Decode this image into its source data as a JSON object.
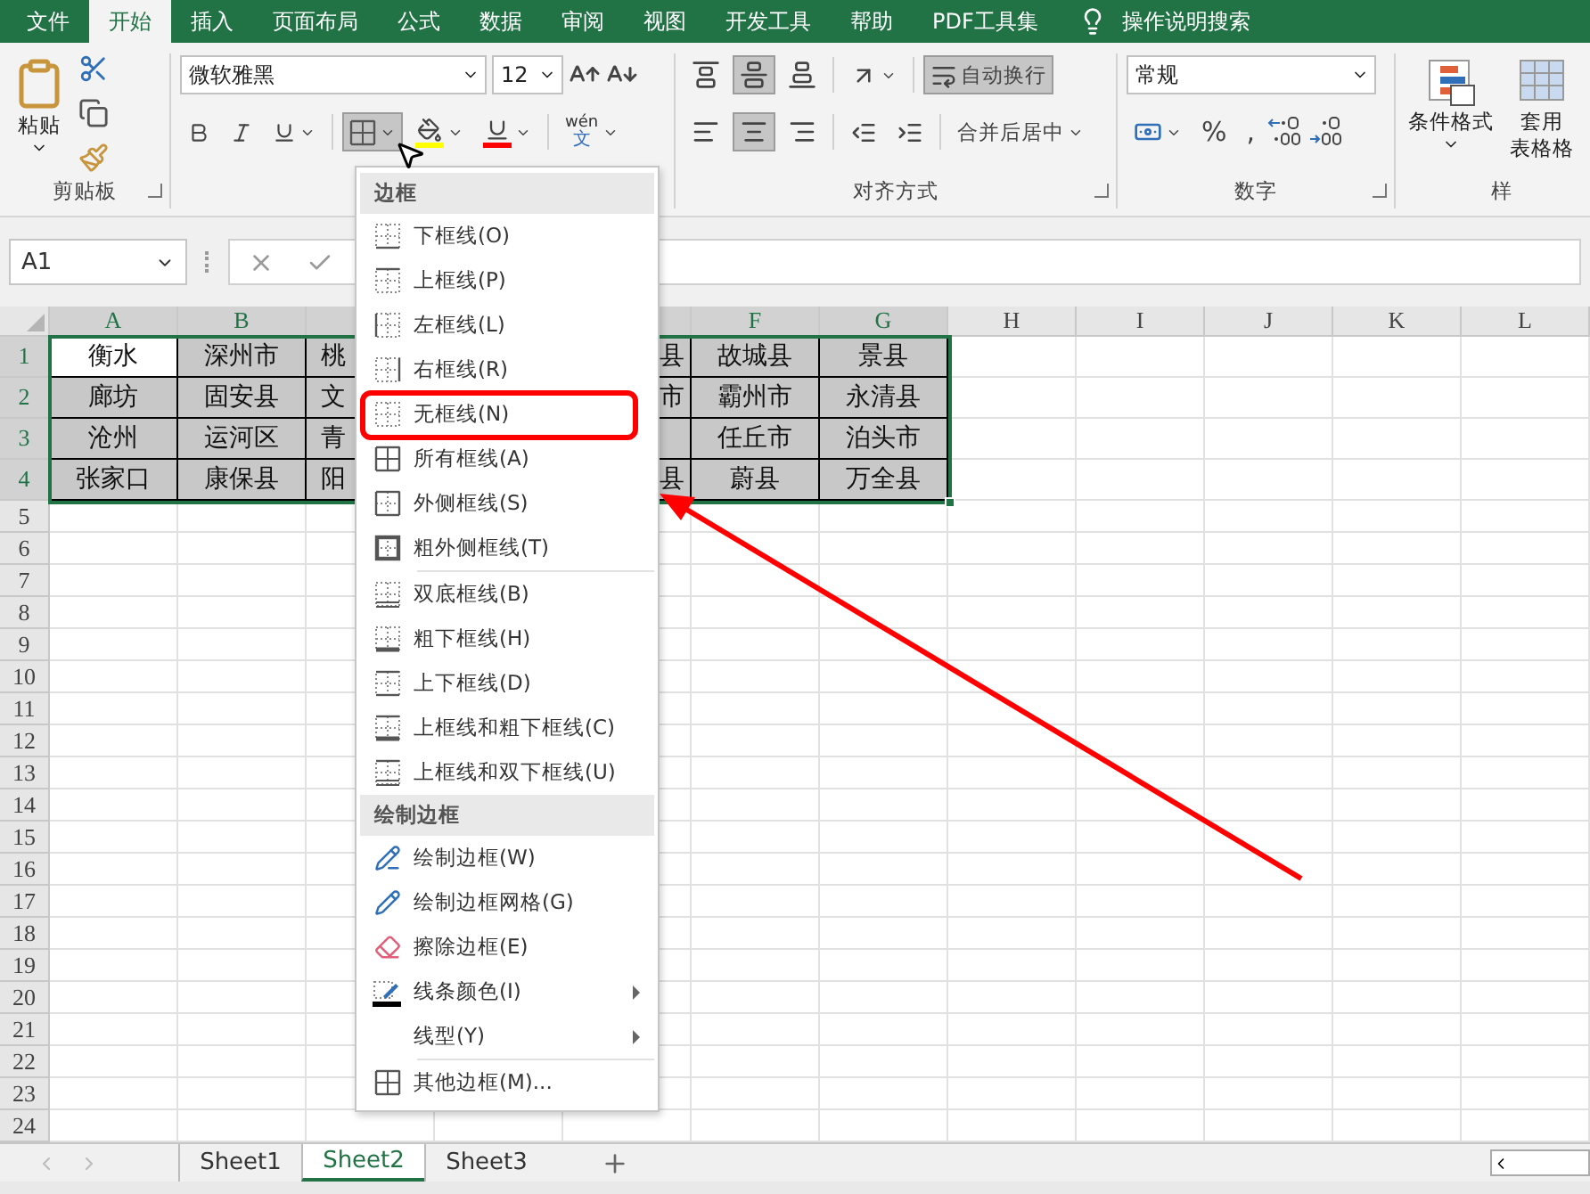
{
  "ribbon_tabs": [
    {
      "label": "文件",
      "selected": false
    },
    {
      "label": "开始",
      "selected": true
    },
    {
      "label": "插入",
      "selected": false
    },
    {
      "label": "页面布局",
      "selected": false
    },
    {
      "label": "公式",
      "selected": false
    },
    {
      "label": "数据",
      "selected": false
    },
    {
      "label": "审阅",
      "selected": false
    },
    {
      "label": "视图",
      "selected": false
    },
    {
      "label": "开发工具",
      "selected": false
    },
    {
      "label": "帮助",
      "selected": false
    },
    {
      "label": "PDF工具集",
      "selected": false
    }
  ],
  "tell_me": "操作说明搜索",
  "ribbon": {
    "clipboard": {
      "paste": "粘贴",
      "label": "剪贴板"
    },
    "font": {
      "name": "微软雅黑",
      "size": "12",
      "phonetic": "wén",
      "phonetic_char": "文",
      "borders_pressed": true
    },
    "alignment": {
      "middle_pressed": true,
      "center_pressed": true,
      "wrap": "自动换行",
      "wrap_pressed": true,
      "merge": "合并后居中",
      "label": "对齐方式"
    },
    "number": {
      "format": "常规",
      "percent": "%",
      "comma": ",",
      "label": "数字"
    },
    "styles": {
      "conditional": "条件格式",
      "table_top": "套用",
      "table_bottom": "表格格",
      "label": "样"
    }
  },
  "formula_bar": {
    "name_box": "A1"
  },
  "columns": [
    {
      "label": "A",
      "selected": true
    },
    {
      "label": "B",
      "selected": true
    },
    {
      "selected": true
    },
    null,
    {
      "selected": true
    },
    {
      "label": "F",
      "selected": true
    },
    {
      "label": "G",
      "selected": true
    },
    {
      "label": "H",
      "selected": false
    },
    {
      "label": "I",
      "selected": false
    },
    {
      "label": "J",
      "selected": false
    },
    {
      "label": "K",
      "selected": false
    },
    {
      "label": "L",
      "selected": false
    }
  ],
  "row_numbers": [
    {
      "label": "1",
      "selected": true
    },
    {
      "label": "2",
      "selected": true
    },
    {
      "label": "3",
      "selected": true
    },
    {
      "label": "4",
      "selected": true
    },
    {
      "label": "5",
      "selected": false
    },
    {
      "label": "6",
      "selected": false
    },
    {
      "label": "7",
      "selected": false
    },
    {
      "label": "8",
      "selected": false
    },
    {
      "label": "9",
      "selected": false
    },
    {
      "label": "10",
      "selected": false
    },
    {
      "label": "11",
      "selected": false
    },
    {
      "label": "12",
      "selected": false
    },
    {
      "label": "13",
      "selected": false
    },
    {
      "label": "14",
      "selected": false
    },
    {
      "label": "15",
      "selected": false
    },
    {
      "label": "16",
      "selected": false
    },
    {
      "label": "17",
      "selected": false
    },
    {
      "label": "18",
      "selected": false
    },
    {
      "label": "19",
      "selected": false
    },
    {
      "label": "20",
      "selected": false
    },
    {
      "label": "21",
      "selected": false
    },
    {
      "label": "22",
      "selected": false
    },
    {
      "label": "23",
      "selected": false
    },
    {
      "label": "24",
      "selected": false
    }
  ],
  "data_rows": [
    [
      {
        "text": "衡水",
        "selected": true
      },
      {
        "text": "深州市",
        "selected": false
      },
      {
        "text": "桃",
        "cut_right": true,
        "selected": false
      },
      null,
      {
        "text": "县",
        "cut_left": true,
        "selected": false
      },
      {
        "text": "故城县",
        "selected": false
      },
      {
        "text": "景县",
        "selected": false
      }
    ],
    [
      {
        "text": "廊坊",
        "selected": false
      },
      {
        "text": "固安县",
        "selected": false
      },
      {
        "text": "文",
        "cut_right": true,
        "selected": false
      },
      null,
      {
        "text": "市",
        "cut_left": true,
        "selected": false
      },
      {
        "text": "霸州市",
        "selected": false
      },
      {
        "text": "永清县",
        "selected": false
      }
    ],
    [
      {
        "text": "沧州",
        "selected": false
      },
      {
        "text": "运河区",
        "selected": false
      },
      {
        "text": "青",
        "cut_right": true,
        "selected": false
      },
      null,
      {
        "selected": false
      },
      {
        "text": "任丘市",
        "selected": false
      },
      {
        "text": "泊头市",
        "selected": false
      }
    ],
    [
      {
        "text": "张家口",
        "selected": false
      },
      {
        "text": "康保县",
        "selected": false
      },
      {
        "text": "阳",
        "cut_right": true,
        "selected": false
      },
      null,
      {
        "text": "县",
        "cut_left": true,
        "selected": false
      },
      {
        "text": "蔚县",
        "selected": false
      },
      {
        "text": "万全县",
        "selected": false
      }
    ]
  ],
  "border_menu": {
    "sections": [
      {
        "title": "边框",
        "groups": [
          [
            {
              "label": "下框线(O)",
              "highlighted": false
            },
            {
              "label": "上框线(P)",
              "highlighted": false
            },
            {
              "label": "左框线(L)",
              "highlighted": false
            },
            {
              "label": "右框线(R)",
              "highlighted": false
            },
            {
              "label": "无框线(N)",
              "highlighted": true
            },
            {
              "label": "所有框线(A)",
              "highlighted": false
            },
            {
              "label": "外侧框线(S)",
              "highlighted": false
            },
            {
              "label": "粗外侧框线(T)",
              "highlighted": false
            }
          ],
          [
            {
              "label": "双底框线(B)",
              "highlighted": false
            },
            {
              "label": "粗下框线(H)",
              "highlighted": false
            },
            {
              "label": "上下框线(D)",
              "highlighted": false
            },
            {
              "label": "上框线和粗下框线(C)",
              "highlighted": false
            },
            {
              "label": "上框线和双下框线(U)",
              "highlighted": false
            }
          ]
        ]
      },
      {
        "title": "绘制边框",
        "groups": [
          [
            {
              "label": "绘制边框(W)",
              "submenu": false
            },
            {
              "label": "绘制边框网格(G)",
              "submenu": false
            },
            {
              "label": "擦除边框(E)",
              "submenu": false
            },
            {
              "label": "线条颜色(I)",
              "submenu": true
            },
            {
              "label": "线型(Y)",
              "submenu": true
            }
          ],
          [
            {
              "label": "其他边框(M)...",
              "submenu": false
            }
          ]
        ]
      }
    ]
  },
  "sheets": [
    {
      "label": "Sheet1",
      "selected": false
    },
    {
      "label": "Sheet2",
      "selected": true
    },
    {
      "label": "Sheet3",
      "selected": false
    }
  ]
}
